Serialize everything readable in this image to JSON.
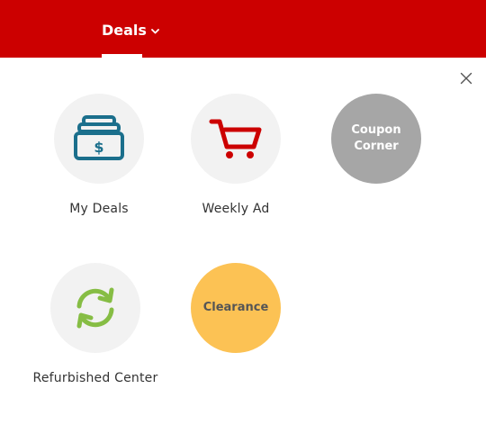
{
  "nav": {
    "deals_label": "Deals",
    "accent_color": "#cc0000"
  },
  "flyout": {
    "close_icon": "close-icon",
    "tiles": [
      {
        "label": "My Deals",
        "icon": "deals-stack-icon"
      },
      {
        "label": "Weekly Ad",
        "icon": "cart-icon"
      },
      {
        "circle_text_line1": "Coupon",
        "circle_text_line2": "Corner",
        "color": "#a6a6a6"
      },
      {
        "label": "Refurbished Center",
        "icon": "refresh-icon"
      },
      {
        "circle_text": "Clearance",
        "color": "#fcc254"
      }
    ]
  }
}
